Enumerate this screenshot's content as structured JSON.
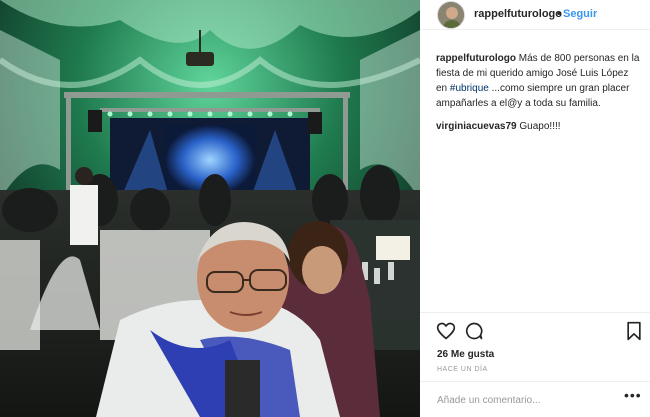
{
  "post": {
    "username": "rappelfuturologo",
    "follow_label": "Seguir",
    "separator": "•",
    "caption_user": "rappelfuturologo",
    "caption_part1": " Más de 800 personas en la fiesta de mi querido amigo José Luis López en ",
    "caption_hashtag": "#ubrique",
    "caption_part2": " ...como siempre un gran placer ampañarles a el@y a toda su familia.",
    "comments": [
      {
        "user": "virginiacuevas79",
        "text": " Guapo!!!!"
      }
    ],
    "likes": "26 Me gusta",
    "timestamp": "HACE UN DÍA",
    "comment_placeholder": "Añade un comentario...",
    "more_label": "•••"
  },
  "icons": {
    "like": "heart-icon",
    "comment": "comment-icon",
    "save": "bookmark-icon"
  },
  "colors": {
    "link": "#3897f0",
    "hashtag": "#003569",
    "text": "#262626",
    "muted": "#999999"
  }
}
